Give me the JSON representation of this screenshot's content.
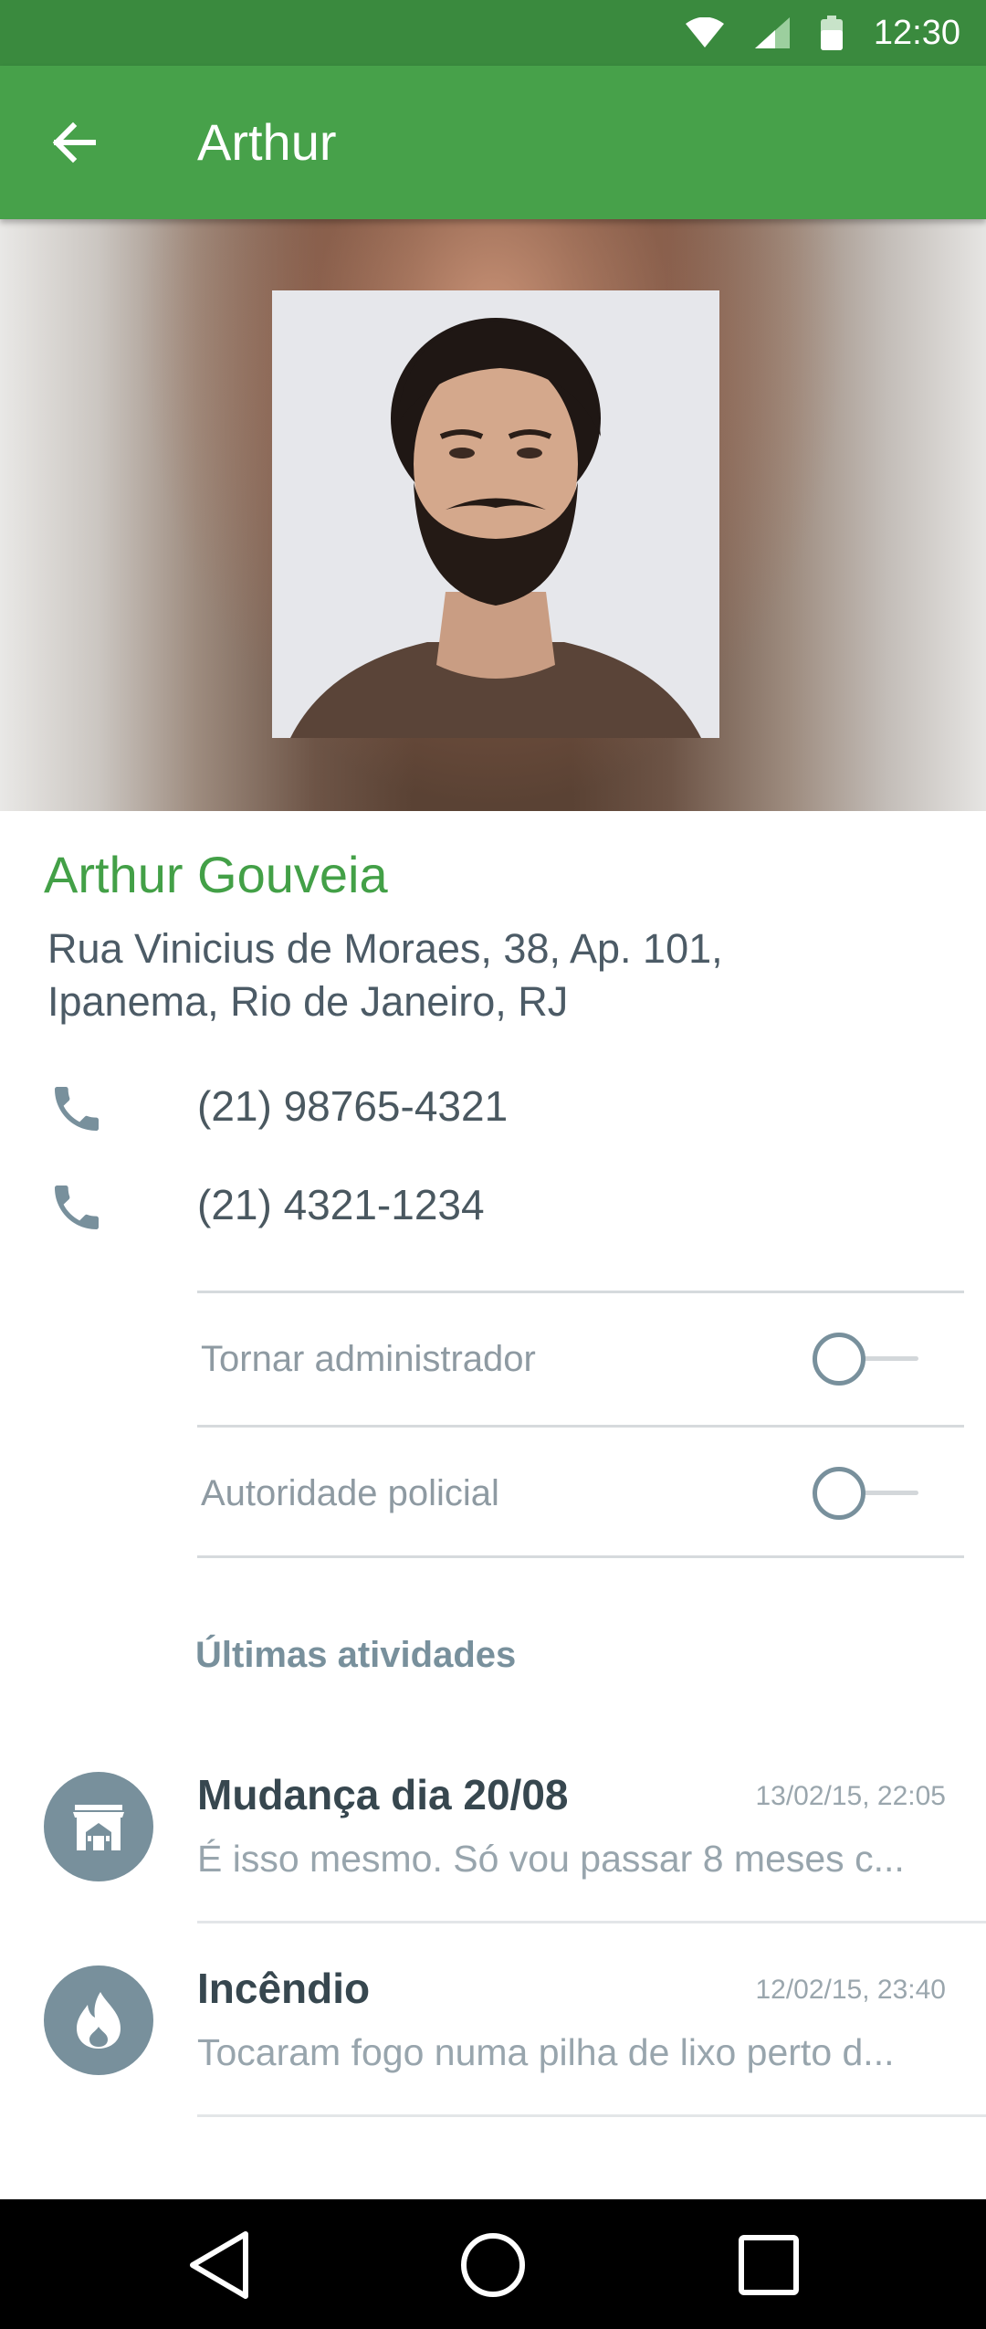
{
  "status_bar": {
    "time": "12:30",
    "icons": [
      "wifi-icon",
      "signal-icon",
      "battery-icon"
    ]
  },
  "app_bar": {
    "title": "Arthur",
    "back_icon": "arrow-back-icon"
  },
  "profile": {
    "name": "Arthur Gouveia",
    "address": "Rua Vinicius de Moraes, 38, Ap. 101, Ipanema, Rio de Janeiro, RJ",
    "phones": [
      {
        "number": "(21) 98765-4321",
        "icon": "phone-icon"
      },
      {
        "number": "(21) 4321-1234",
        "icon": "phone-icon"
      }
    ]
  },
  "settings": [
    {
      "label": "Tornar administrador",
      "enabled": false
    },
    {
      "label": "Autoridade policial",
      "enabled": false
    }
  ],
  "activities": {
    "title": "Últimas atividades",
    "items": [
      {
        "title": "Mudança dia 20/08",
        "time": "13/02/15, 22:05",
        "snippet": "É isso mesmo. Só vou passar 8 meses c...",
        "icon": "moving-house-icon"
      },
      {
        "title": "Incêndio",
        "time": "12/02/15, 23:40",
        "snippet": "Tocaram fogo numa pilha de lixo perto d...",
        "icon": "fire-icon"
      }
    ]
  },
  "nav_bar": {
    "buttons": [
      "back-triangle-icon",
      "home-circle-icon",
      "recents-square-icon"
    ]
  },
  "colors": {
    "primary": "#47a14a",
    "primary_dark": "#3a8a3e",
    "accent_text": "#43a047",
    "icon_gray": "#78909c"
  }
}
